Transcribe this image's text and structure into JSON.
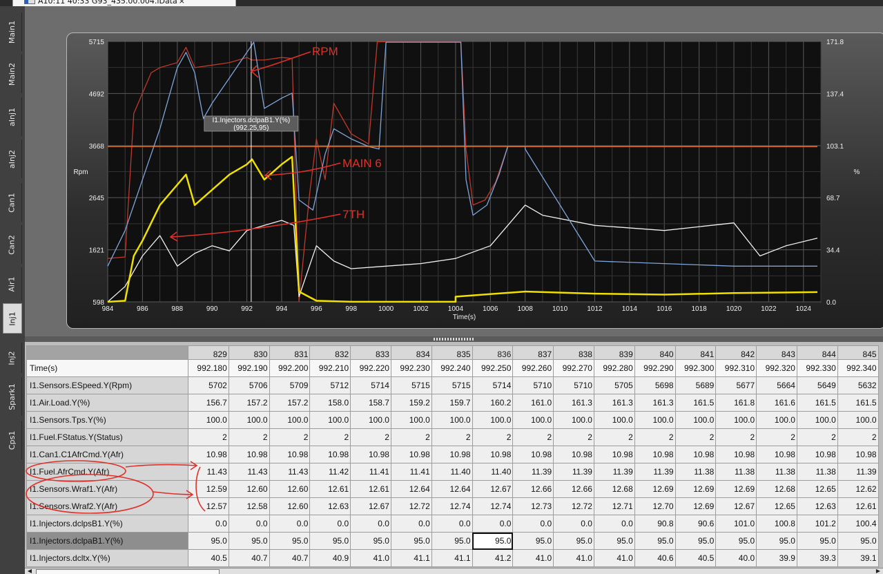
{
  "window": {
    "file_tab_title": "A10:11 40:33 G93_435.00.004.lData",
    "close_glyph": "×"
  },
  "side_tabs": [
    "Main1",
    "Main2",
    "aInj1",
    "aInj2",
    "Can1",
    "Can2",
    "Air1",
    "Inj1",
    "Inj2",
    "Spark1",
    "Cps1"
  ],
  "active_side_tab": "Inj1",
  "chart_data": {
    "type": "line",
    "xlabel": "Time(s)",
    "ylabel_left": "Rpm",
    "ylabel_right": "%",
    "xlim": [
      984,
      1025
    ],
    "ylim_left": [
      598,
      5715
    ],
    "ylim_right": [
      0.0,
      171.8
    ],
    "x_ticks": [
      "984",
      "986",
      "988",
      "990",
      "992",
      "994",
      "996",
      "998",
      "1000",
      "1002",
      "1004",
      "1006",
      "1008",
      "1010",
      "1012",
      "1014",
      "1016",
      "1018",
      "1020",
      "1022",
      "1024"
    ],
    "y_ticks_left": [
      "598",
      "1621",
      "2645",
      "3668",
      "4692",
      "5715"
    ],
    "y_ticks_right": [
      "0.0",
      "34.4",
      "68.7",
      "103.1",
      "137.4",
      "171.8"
    ],
    "grid": true,
    "cursor_tooltip": {
      "label": "I1.Injectors.dclpaB1.Y(%)",
      "value": "(992.25,95)"
    },
    "series": [
      {
        "color": "#c0392b",
        "axis": "left",
        "points": [
          [
            984,
            1450
          ],
          [
            985,
            1480
          ],
          [
            985.5,
            4300
          ],
          [
            986,
            4700
          ],
          [
            986.5,
            5100
          ],
          [
            987,
            5200
          ],
          [
            988,
            5300
          ],
          [
            988.5,
            5600
          ],
          [
            989,
            5200
          ],
          [
            990,
            5250
          ],
          [
            991,
            5300
          ],
          [
            992,
            5400
          ],
          [
            992.3,
            5350
          ],
          [
            993,
            5350
          ],
          [
            994,
            5400
          ],
          [
            994.6,
            5380
          ],
          [
            995,
            600
          ],
          [
            995.6,
            2700
          ],
          [
            996,
            3800
          ],
          [
            996.5,
            3000
          ],
          [
            997,
            4500
          ],
          [
            998,
            3900
          ],
          [
            999,
            3700
          ],
          [
            999.5,
            5710
          ],
          [
            1001,
            5710
          ],
          [
            1003,
            5710
          ],
          [
            1004.3,
            5710
          ],
          [
            1004.6,
            3600
          ],
          [
            1005,
            2500
          ],
          [
            1005.7,
            2600
          ],
          [
            1006.3,
            2950
          ],
          [
            1007,
            3650
          ],
          [
            1024.8,
            3650
          ]
        ]
      },
      {
        "color": "#f2f2f2",
        "axis": "left",
        "points": [
          [
            984,
            598
          ],
          [
            985,
            900
          ],
          [
            986,
            1500
          ],
          [
            987,
            1900
          ],
          [
            988,
            1300
          ],
          [
            989,
            1550
          ],
          [
            990,
            1700
          ],
          [
            991,
            1600
          ],
          [
            992,
            2000
          ],
          [
            993,
            2100
          ],
          [
            994,
            2200
          ],
          [
            994.7,
            2100
          ],
          [
            995,
            700
          ],
          [
            996,
            1700
          ],
          [
            997,
            1400
          ],
          [
            998,
            1250
          ],
          [
            1000,
            1300
          ],
          [
            1002,
            1350
          ],
          [
            1004,
            1450
          ],
          [
            1006,
            1700
          ],
          [
            1007,
            2100
          ],
          [
            1008,
            2500
          ],
          [
            1009,
            2300
          ],
          [
            1012,
            2100
          ],
          [
            1016,
            2000
          ],
          [
            1020,
            2150
          ],
          [
            1021.5,
            1500
          ],
          [
            1023,
            1700
          ],
          [
            1024.8,
            1850
          ]
        ]
      },
      {
        "color": "#7fa6dc",
        "axis": "left",
        "points": [
          [
            984,
            1300
          ],
          [
            985,
            2000
          ],
          [
            986,
            3000
          ],
          [
            987,
            4000
          ],
          [
            988,
            5200
          ],
          [
            988.5,
            5500
          ],
          [
            989,
            5100
          ],
          [
            989.5,
            4200
          ],
          [
            990,
            4500
          ],
          [
            991,
            5000
          ],
          [
            992,
            5500
          ],
          [
            992.4,
            5700
          ],
          [
            993,
            4400
          ],
          [
            994,
            4600
          ],
          [
            994.6,
            4700
          ],
          [
            995,
            2600
          ],
          [
            995.8,
            2400
          ],
          [
            996.5,
            3500
          ],
          [
            997,
            4000
          ],
          [
            998,
            3800
          ],
          [
            999,
            3650
          ],
          [
            999.6,
            3600
          ],
          [
            1000,
            5700
          ],
          [
            1004.3,
            5700
          ],
          [
            1004.6,
            3000
          ],
          [
            1005,
            2300
          ],
          [
            1005.8,
            2500
          ],
          [
            1006.5,
            3100
          ],
          [
            1007,
            3650
          ],
          [
            1008,
            3650
          ],
          [
            1008,
            3600
          ],
          [
            1012,
            1400
          ],
          [
            1016,
            1350
          ],
          [
            1020,
            1300
          ],
          [
            1024.8,
            1300
          ]
        ]
      },
      {
        "color": "#f0e000",
        "axis": "left",
        "points": [
          [
            984,
            598
          ],
          [
            985,
            620
          ],
          [
            985.5,
            1500
          ],
          [
            986,
            1800
          ],
          [
            987,
            2500
          ],
          [
            988,
            2900
          ],
          [
            988.5,
            3100
          ],
          [
            989,
            2500
          ],
          [
            990,
            2800
          ],
          [
            991,
            3100
          ],
          [
            992,
            3300
          ],
          [
            992.3,
            3400
          ],
          [
            993,
            3000
          ],
          [
            994,
            3300
          ],
          [
            994.6,
            3450
          ],
          [
            995,
            800
          ],
          [
            996,
            620
          ],
          [
            998,
            600
          ],
          [
            1000,
            600
          ],
          [
            1004,
            600
          ],
          [
            1004,
            700
          ],
          [
            1006,
            750
          ],
          [
            1008,
            800
          ],
          [
            1012,
            760
          ],
          [
            1016,
            740
          ],
          [
            1020,
            770
          ],
          [
            1024.8,
            790
          ]
        ]
      },
      {
        "color": "#ff7a1a",
        "axis": "left",
        "points": [
          [
            984,
            3650
          ],
          [
            1024.8,
            3650
          ]
        ]
      }
    ]
  },
  "grid": {
    "header_label": "",
    "columns": [
      "829",
      "830",
      "831",
      "832",
      "833",
      "834",
      "835",
      "836",
      "837",
      "838",
      "839",
      "840",
      "841",
      "842",
      "843",
      "844",
      "845"
    ],
    "selected_column": "836",
    "selected_row": 11,
    "rows": [
      {
        "label": "Time(s)",
        "values": [
          "992.180",
          "992.190",
          "992.200",
          "992.210",
          "992.220",
          "992.230",
          "992.240",
          "992.250",
          "992.260",
          "992.270",
          "992.280",
          "992.290",
          "992.300",
          "992.310",
          "992.320",
          "992.330",
          "992.340"
        ]
      },
      {
        "label": "I1.Sensors.ESpeed.Y(Rpm)",
        "values": [
          "5702",
          "5706",
          "5709",
          "5712",
          "5714",
          "5715",
          "5715",
          "5714",
          "5710",
          "5710",
          "5705",
          "5698",
          "5689",
          "5677",
          "5664",
          "5649",
          "5632"
        ]
      },
      {
        "label": "I1.Air.Load.Y(%)",
        "values": [
          "156.7",
          "157.2",
          "157.2",
          "158.0",
          "158.7",
          "159.2",
          "159.7",
          "160.2",
          "161.0",
          "161.3",
          "161.3",
          "161.3",
          "161.5",
          "161.8",
          "161.6",
          "161.5",
          "161.5"
        ]
      },
      {
        "label": "I1.Sensors.Tps.Y(%)",
        "values": [
          "100.0",
          "100.0",
          "100.0",
          "100.0",
          "100.0",
          "100.0",
          "100.0",
          "100.0",
          "100.0",
          "100.0",
          "100.0",
          "100.0",
          "100.0",
          "100.0",
          "100.0",
          "100.0",
          "100.0"
        ]
      },
      {
        "label": "I1.Fuel.FStatus.Y(Status)",
        "values": [
          "2",
          "2",
          "2",
          "2",
          "2",
          "2",
          "2",
          "2",
          "2",
          "2",
          "2",
          "2",
          "2",
          "2",
          "2",
          "2",
          "2"
        ]
      },
      {
        "label": "I1.Can1.C1AfrCmd.Y(Afr)",
        "values": [
          "10.98",
          "10.98",
          "10.98",
          "10.98",
          "10.98",
          "10.98",
          "10.98",
          "10.98",
          "10.98",
          "10.98",
          "10.98",
          "10.98",
          "10.98",
          "10.98",
          "10.98",
          "10.98",
          "10.98"
        ]
      },
      {
        "label": "I1.Fuel.AfrCmd.Y(Afr)",
        "values": [
          "11.43",
          "11.43",
          "11.43",
          "11.42",
          "11.41",
          "11.41",
          "11.40",
          "11.40",
          "11.39",
          "11.39",
          "11.39",
          "11.39",
          "11.38",
          "11.38",
          "11.38",
          "11.38",
          "11.39"
        ]
      },
      {
        "label": "I1.Sensors.Wraf1.Y(Afr)",
        "values": [
          "12.59",
          "12.60",
          "12.60",
          "12.61",
          "12.61",
          "12.64",
          "12.64",
          "12.67",
          "12.66",
          "12.66",
          "12.68",
          "12.69",
          "12.69",
          "12.69",
          "12.68",
          "12.65",
          "12.62"
        ]
      },
      {
        "label": "I1.Sensors.Wraf2.Y(Afr)",
        "values": [
          "12.57",
          "12.58",
          "12.60",
          "12.63",
          "12.67",
          "12.72",
          "12.74",
          "12.74",
          "12.73",
          "12.72",
          "12.71",
          "12.70",
          "12.69",
          "12.67",
          "12.65",
          "12.63",
          "12.61"
        ]
      },
      {
        "label": "I1.Injectors.dclpsB1.Y(%)",
        "values": [
          "0.0",
          "0.0",
          "0.0",
          "0.0",
          "0.0",
          "0.0",
          "0.0",
          "0.0",
          "0.0",
          "0.0",
          "0.0",
          "90.8",
          "90.6",
          "101.0",
          "100.8",
          "101.2",
          "100.4"
        ]
      },
      {
        "label": "I1.Injectors.dclpaB1.Y(%)",
        "values": [
          "95.0",
          "95.0",
          "95.0",
          "95.0",
          "95.0",
          "95.0",
          "95.0",
          "95.0",
          "95.0",
          "95.0",
          "95.0",
          "95.0",
          "95.0",
          "95.0",
          "95.0",
          "95.0",
          "95.0"
        ]
      },
      {
        "label": "I1.Injectors.dcltx.Y(%)",
        "values": [
          "40.5",
          "40.7",
          "40.7",
          "40.9",
          "41.0",
          "41.1",
          "41.1",
          "41.2",
          "41.0",
          "41.0",
          "41.0",
          "40.6",
          "40.5",
          "40.0",
          "39.9",
          "39.3",
          "39.1"
        ]
      }
    ]
  },
  "annotations": {
    "rpm": "RPM",
    "main6": "MAIN 6",
    "seventh": "7TH"
  },
  "colors": {
    "annotation": "#e0302a",
    "background": "#3c3c3c"
  }
}
